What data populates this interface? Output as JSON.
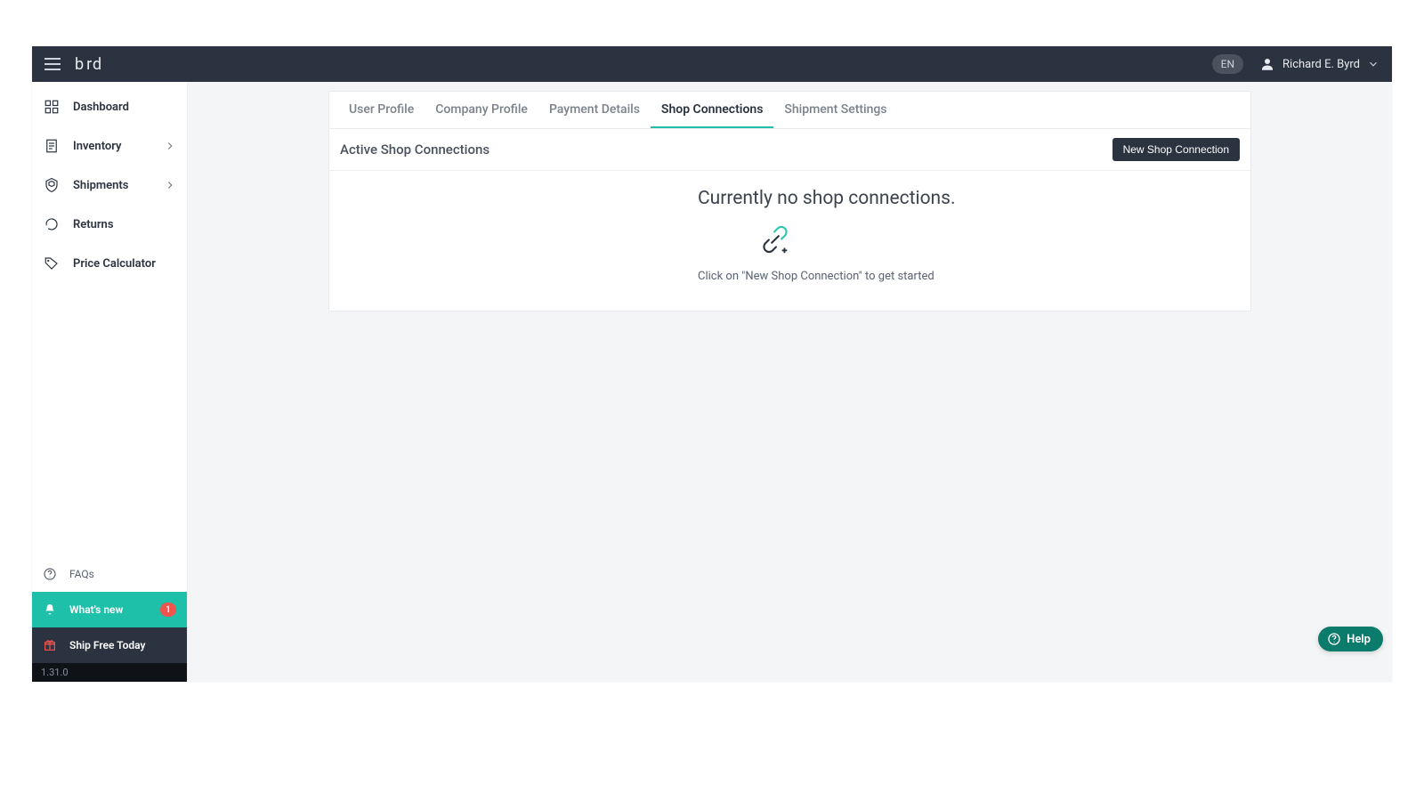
{
  "header": {
    "language": "EN",
    "user_name": "Richard E. Byrd",
    "logo_text_b": "b",
    "logo_text_rd": "rd"
  },
  "sidebar": {
    "items": [
      {
        "label": "Dashboard",
        "icon": "dashboard",
        "expandable": false
      },
      {
        "label": "Inventory",
        "icon": "inventory",
        "expandable": true
      },
      {
        "label": "Shipments",
        "icon": "shipments",
        "expandable": true
      },
      {
        "label": "Returns",
        "icon": "returns",
        "expandable": false
      },
      {
        "label": "Price Calculator",
        "icon": "price",
        "expandable": false
      }
    ],
    "faq_label": "FAQs",
    "whats_new_label": "What's new",
    "whats_new_count": "1",
    "ship_free_label": "Ship Free Today",
    "version": "1.31.0"
  },
  "tabs": [
    {
      "label": "User Profile",
      "active": false
    },
    {
      "label": "Company Profile",
      "active": false
    },
    {
      "label": "Payment Details",
      "active": false
    },
    {
      "label": "Shop Connections",
      "active": true
    },
    {
      "label": "Shipment Settings",
      "active": false
    }
  ],
  "section": {
    "title": "Active Shop Connections",
    "new_button": "New Shop Connection",
    "empty_title": "Currently no shop connections.",
    "empty_sub": "Click on \"New Shop Connection\" to get started"
  },
  "help_label": "Help"
}
